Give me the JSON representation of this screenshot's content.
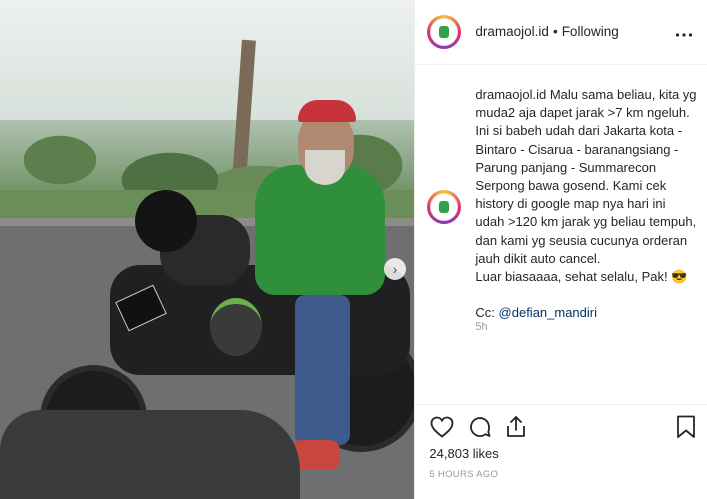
{
  "post": {
    "image_alt": "Man in green jacket and red cap sitting on a motorcycle on a roadside",
    "next_arrow": "›"
  },
  "header": {
    "username": "dramaojol.id",
    "separator": "•",
    "follow_status": "Following",
    "more_label": "•••"
  },
  "caption": {
    "username": "dramaojol.id",
    "text": " Malu sama beliau, kita yg muda2 aja dapet jarak >7 km ngeluh. Ini si babeh udah dari Jakarta kota - Bintaro - Cisarua - baranangsiang - Parung panjang - Summarecon Serpong bawa gosend. Kami cek history di google map nya hari ini udah >120 km jarak yg beliau tempuh, dan kami yg seusia cucunya orderan jauh dikit auto cancel.\nLuar biasaaaa, sehat selalu, Pak! 😎\n\nCc: ",
    "mention": "@defian_mandiri",
    "age": "5h"
  },
  "actions": {
    "like_icon": "heart-icon",
    "comment_icon": "comment-icon",
    "share_icon": "share-icon",
    "save_icon": "bookmark-icon"
  },
  "stats": {
    "likes": "24,803 likes",
    "posted": "5 HOURS AGO"
  }
}
